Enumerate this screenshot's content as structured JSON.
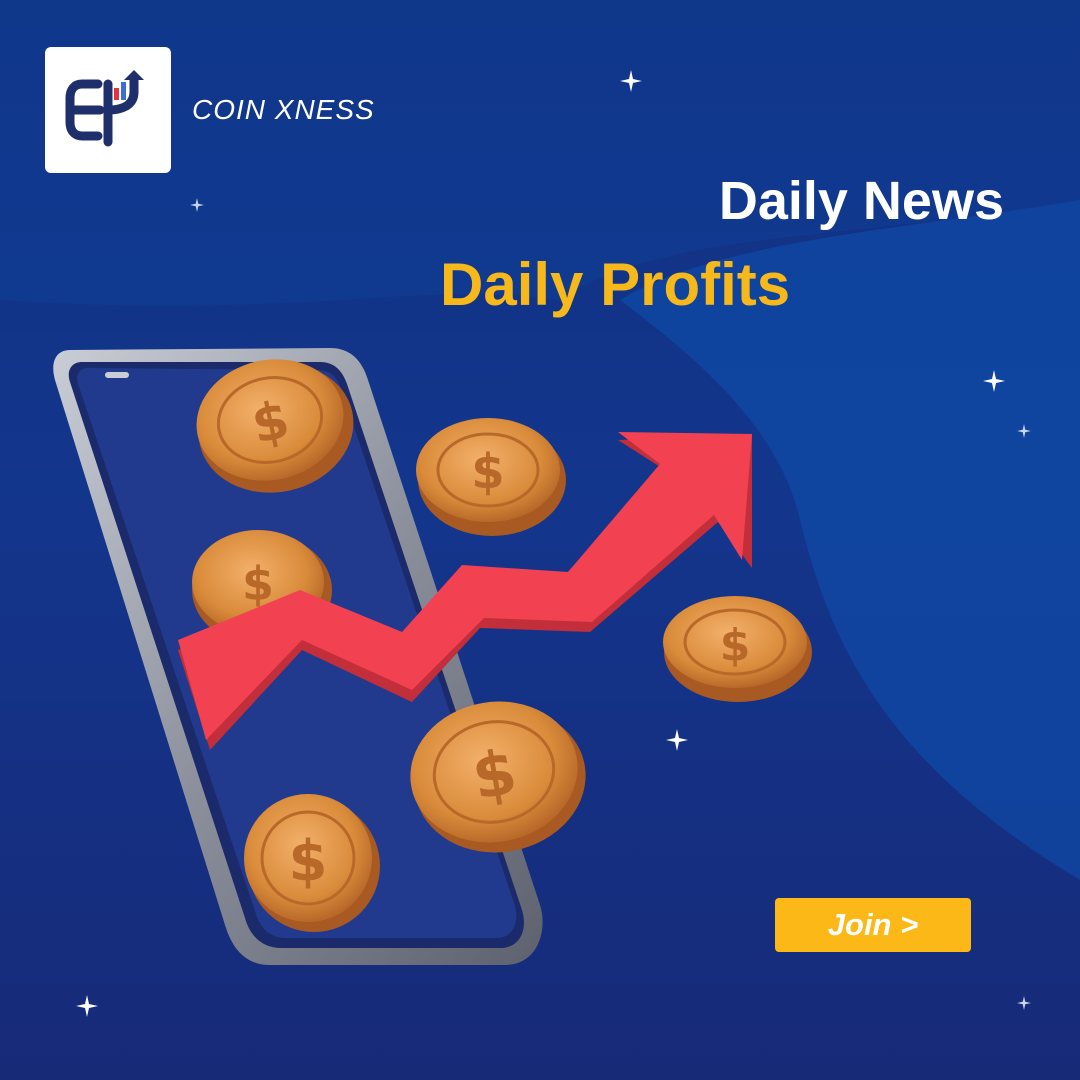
{
  "brand": {
    "name": "COIN XNESS",
    "logo_icon": "ex-growth-arrow-icon",
    "colors": {
      "navy": "#1f2f6b",
      "red": "#e3343f",
      "blue": "#3a6fd6"
    }
  },
  "headline": {
    "line1": "Daily News",
    "line2": "Daily Profits"
  },
  "cta": {
    "label": "Join >"
  },
  "illustration": {
    "icons": [
      "smartphone-icon",
      "dollar-coin-icon",
      "rising-arrow-icon",
      "sparkle-icon"
    ]
  },
  "colors": {
    "background": "#13368d",
    "accent": "#f6b81a",
    "arrow": "#f24150",
    "coin": "#d98b3a"
  }
}
